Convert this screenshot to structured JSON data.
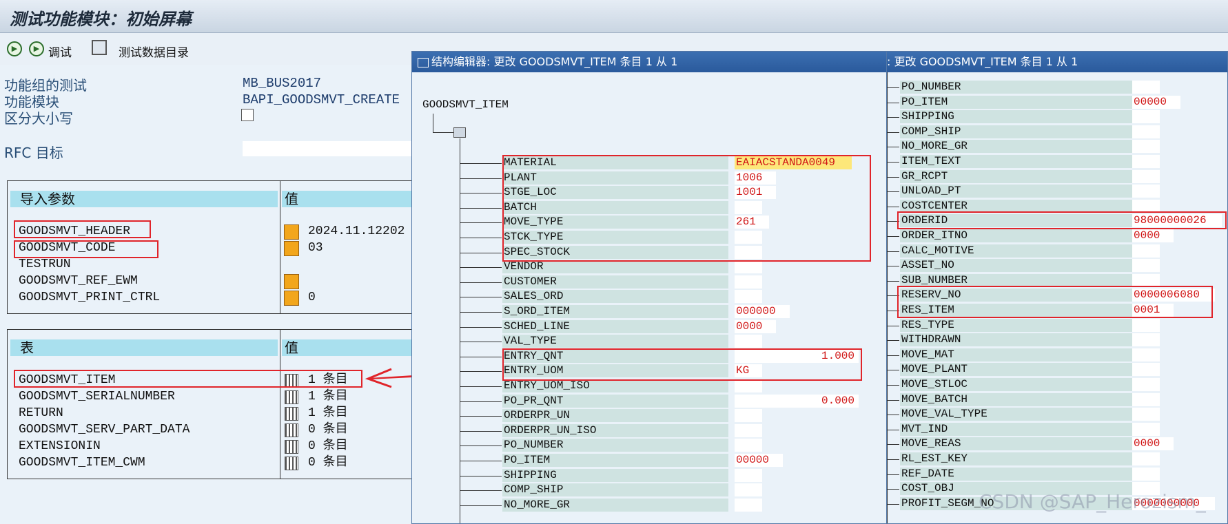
{
  "window_title": "测试功能模块：初始屏幕",
  "toolbar": {
    "debug_label": "调试",
    "test_dir_label": "测试数据目录"
  },
  "header": {
    "func_group_label": "功能组的测试",
    "func_group_value": "MB_BUS2017",
    "func_module_label": "功能模块",
    "func_module_value": "BAPI_GOODSMVT_CREATE",
    "case_label": "区分大小写",
    "rfc_label": "RFC 目标"
  },
  "import_params": {
    "col_param": "导入参数",
    "col_value": "值",
    "rows": [
      {
        "name": "GOODSMVT_HEADER",
        "value": "2024.11.12202"
      },
      {
        "name": "GOODSMVT_CODE",
        "value": "03"
      },
      {
        "name": "TESTRUN",
        "value": ""
      },
      {
        "name": "GOODSMVT_REF_EWM",
        "value": ""
      },
      {
        "name": "GOODSMVT_PRINT_CTRL",
        "value": "0"
      }
    ]
  },
  "tables": {
    "col_table": "表",
    "col_value": "值",
    "rows": [
      {
        "name": "GOODSMVT_ITEM",
        "value": "1 条目"
      },
      {
        "name": "GOODSMVT_SERIALNUMBER",
        "value": "1 条目"
      },
      {
        "name": "RETURN",
        "value": "1 条目"
      },
      {
        "name": "GOODSMVT_SERV_PART_DATA",
        "value": "0 条目"
      },
      {
        "name": "EXTENSIONIN",
        "value": "0 条目"
      },
      {
        "name": "GOODSMVT_ITEM_CWM",
        "value": "0 条目"
      }
    ]
  },
  "editor1": {
    "title": "结构编辑器: 更改 GOODSMVT_ITEM 条目 1 从 1",
    "root": "GOODSMVT_ITEM",
    "fields": [
      {
        "name": "MATERIAL",
        "value": "EAIACSTANDA0049"
      },
      {
        "name": "PLANT",
        "value": "1006"
      },
      {
        "name": "STGE_LOC",
        "value": "1001"
      },
      {
        "name": "BATCH",
        "value": ""
      },
      {
        "name": "MOVE_TYPE",
        "value": "261"
      },
      {
        "name": "STCK_TYPE",
        "value": ""
      },
      {
        "name": "SPEC_STOCK",
        "value": ""
      },
      {
        "name": "VENDOR",
        "value": ""
      },
      {
        "name": "CUSTOMER",
        "value": ""
      },
      {
        "name": "SALES_ORD",
        "value": ""
      },
      {
        "name": "S_ORD_ITEM",
        "value": "000000"
      },
      {
        "name": "SCHED_LINE",
        "value": "0000"
      },
      {
        "name": "VAL_TYPE",
        "value": ""
      },
      {
        "name": "ENTRY_QNT",
        "value": "1.000"
      },
      {
        "name": "ENTRY_UOM",
        "value": "KG"
      },
      {
        "name": "ENTRY_UOM_ISO",
        "value": ""
      },
      {
        "name": "PO_PR_QNT",
        "value": "0.000"
      },
      {
        "name": "ORDERPR_UN",
        "value": ""
      },
      {
        "name": "ORDERPR_UN_ISO",
        "value": ""
      },
      {
        "name": "PO_NUMBER",
        "value": ""
      },
      {
        "name": "PO_ITEM",
        "value": "00000"
      },
      {
        "name": "SHIPPING",
        "value": ""
      },
      {
        "name": "COMP_SHIP",
        "value": ""
      },
      {
        "name": "NO_MORE_GR",
        "value": ""
      }
    ]
  },
  "editor2": {
    "title": ": 更改 GOODSMVT_ITEM 条目 1 从 1",
    "fields": [
      {
        "name": "PO_NUMBER",
        "value": ""
      },
      {
        "name": "PO_ITEM",
        "value": "00000"
      },
      {
        "name": "SHIPPING",
        "value": ""
      },
      {
        "name": "COMP_SHIP",
        "value": ""
      },
      {
        "name": "NO_MORE_GR",
        "value": ""
      },
      {
        "name": "ITEM_TEXT",
        "value": ""
      },
      {
        "name": "GR_RCPT",
        "value": ""
      },
      {
        "name": "UNLOAD_PT",
        "value": ""
      },
      {
        "name": "COSTCENTER",
        "value": ""
      },
      {
        "name": "ORDERID",
        "value": "98000000026"
      },
      {
        "name": "ORDER_ITNO",
        "value": "0000"
      },
      {
        "name": "CALC_MOTIVE",
        "value": ""
      },
      {
        "name": "ASSET_NO",
        "value": ""
      },
      {
        "name": "SUB_NUMBER",
        "value": ""
      },
      {
        "name": "RESERV_NO",
        "value": "0000006080"
      },
      {
        "name": "RES_ITEM",
        "value": "0001"
      },
      {
        "name": "RES_TYPE",
        "value": ""
      },
      {
        "name": "WITHDRAWN",
        "value": ""
      },
      {
        "name": "MOVE_MAT",
        "value": ""
      },
      {
        "name": "MOVE_PLANT",
        "value": ""
      },
      {
        "name": "MOVE_STLOC",
        "value": ""
      },
      {
        "name": "MOVE_BATCH",
        "value": ""
      },
      {
        "name": "MOVE_VAL_TYPE",
        "value": ""
      },
      {
        "name": "MVT_IND",
        "value": ""
      },
      {
        "name": "MOVE_REAS",
        "value": "0000"
      },
      {
        "name": "RL_EST_KEY",
        "value": ""
      },
      {
        "name": "REF_DATE",
        "value": ""
      },
      {
        "name": "COST_OBJ",
        "value": ""
      },
      {
        "name": "PROFIT_SEGM_NO",
        "value": "0000000000"
      }
    ]
  },
  "watermark": "CSDN @SAP_Herozism_"
}
